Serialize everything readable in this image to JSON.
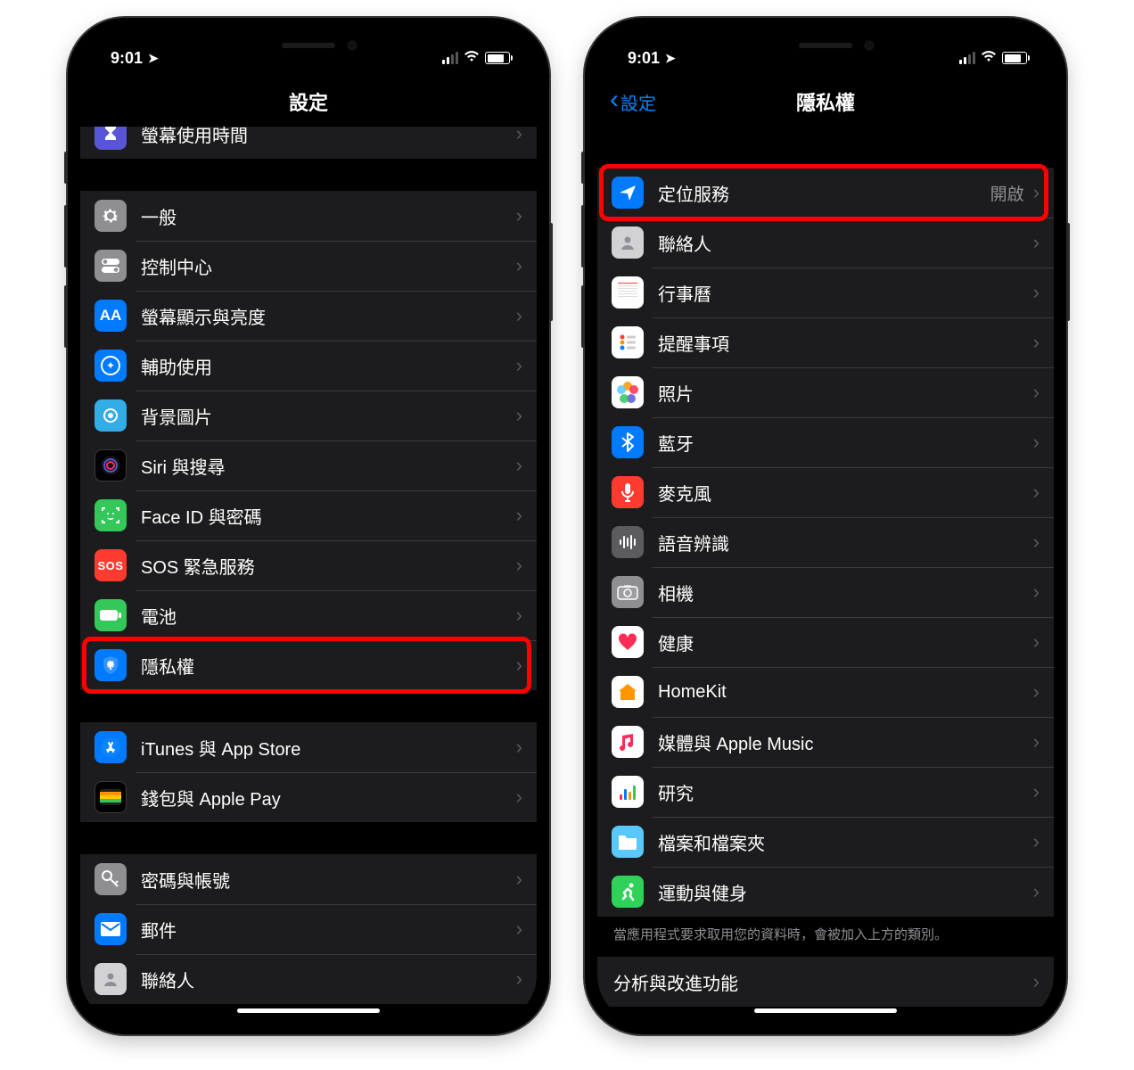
{
  "status": {
    "time": "9:01"
  },
  "left_phone": {
    "nav_title": "設定",
    "groups": [
      [
        {
          "icon": "hourglass-icon",
          "label": "螢幕使用時間",
          "color": "bg-purple"
        }
      ],
      [
        {
          "icon": "gear-icon",
          "label": "一般",
          "color": "bg-gray"
        },
        {
          "icon": "toggles-icon",
          "label": "控制中心",
          "color": "bg-gray"
        },
        {
          "icon": "aa-icon",
          "label": "螢幕顯示與亮度",
          "color": "bg-blue"
        },
        {
          "icon": "accessibility-icon",
          "label": "輔助使用",
          "color": "bg-blue"
        },
        {
          "icon": "wallpaper-icon",
          "label": "背景圖片",
          "color": "bg-cyan"
        },
        {
          "icon": "siri-icon",
          "label": "Siri 與搜尋",
          "color": "bg-black"
        },
        {
          "icon": "faceid-icon",
          "label": "Face ID 與密碼",
          "color": "bg-green"
        },
        {
          "icon": "sos-icon",
          "label": "SOS 緊急服務",
          "color": "bg-red",
          "text": "SOS"
        },
        {
          "icon": "battery-icon",
          "label": "電池",
          "color": "bg-green"
        },
        {
          "icon": "privacy-icon",
          "label": "隱私權",
          "color": "bg-blue",
          "highlight": true
        }
      ],
      [
        {
          "icon": "appstore-icon",
          "label": "iTunes 與 App Store",
          "color": "bg-blue"
        },
        {
          "icon": "wallet-icon",
          "label": "錢包與 Apple Pay",
          "color": "bg-black"
        }
      ],
      [
        {
          "icon": "key-icon",
          "label": "密碼與帳號",
          "color": "bg-gray"
        },
        {
          "icon": "mail-icon",
          "label": "郵件",
          "color": "bg-blue"
        },
        {
          "icon": "contacts-icon",
          "label": "聯絡人",
          "color": "bg-ltgray"
        }
      ]
    ]
  },
  "right_phone": {
    "nav_title": "隱私權",
    "back_label": "設定",
    "groups": [
      [
        {
          "icon": "location-icon",
          "label": "定位服務",
          "color": "bg-blue",
          "value": "開啟",
          "highlight": true
        },
        {
          "icon": "contacts-icon",
          "label": "聯絡人",
          "color": "bg-ltgray"
        },
        {
          "icon": "calendar-icon",
          "label": "行事曆",
          "color": "bg-white"
        },
        {
          "icon": "reminders-icon",
          "label": "提醒事項",
          "color": "bg-white"
        },
        {
          "icon": "photos-icon",
          "label": "照片",
          "color": "bg-white"
        },
        {
          "icon": "bluetooth-icon",
          "label": "藍牙",
          "color": "bg-blue"
        },
        {
          "icon": "microphone-icon",
          "label": "麥克風",
          "color": "bg-red"
        },
        {
          "icon": "speech-icon",
          "label": "語音辨識",
          "color": "bg-graydark"
        },
        {
          "icon": "camera-icon",
          "label": "相機",
          "color": "bg-gray"
        },
        {
          "icon": "health-icon",
          "label": "健康",
          "color": "bg-white"
        },
        {
          "icon": "homekit-icon",
          "label": "HomeKit",
          "color": "bg-white"
        },
        {
          "icon": "music-icon",
          "label": "媒體與 Apple Music",
          "color": "bg-white"
        },
        {
          "icon": "research-icon",
          "label": "研究",
          "color": "bg-white"
        },
        {
          "icon": "files-icon",
          "label": "檔案和檔案夾",
          "color": "bg-lightblue"
        },
        {
          "icon": "fitness-icon",
          "label": "運動與健身",
          "color": "bg-teal"
        }
      ]
    ],
    "footer_note": "當應用程式要求取用您的資料時，會被加入上方的類別。",
    "next_section_row": {
      "label": "分析與改進功能"
    }
  }
}
